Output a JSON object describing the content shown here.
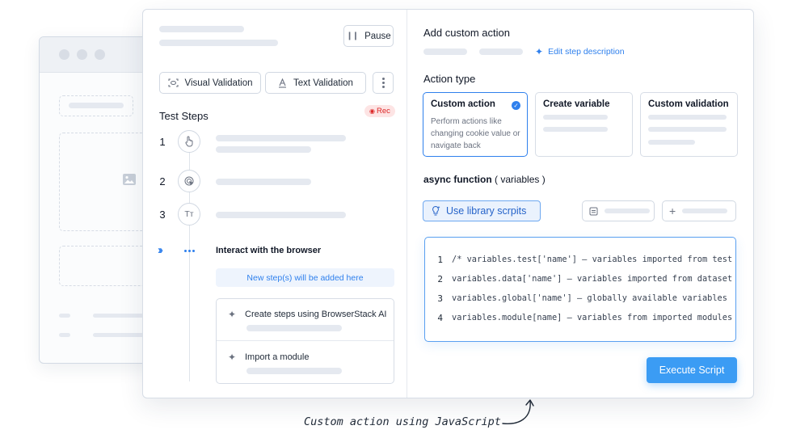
{
  "left_panel": {
    "pause_label": "Pause",
    "visual_validation_label": "Visual Validation",
    "text_validation_label": "Text Validation",
    "test_steps_title": "Test Steps",
    "rec_label": "Rec",
    "steps": [
      {
        "number": "1",
        "icon": "hand-pointer-icon"
      },
      {
        "number": "2",
        "icon": "cursor-click-icon"
      },
      {
        "number": "3",
        "icon": "text-type-icon"
      }
    ],
    "interact_label": "Interact with the browser",
    "new_step_hint": "New step(s) will be added here",
    "options": [
      {
        "label": "Create steps using BrowserStack AI"
      },
      {
        "label": "Import a module"
      }
    ]
  },
  "right_panel": {
    "add_custom_action_title": "Add custom action",
    "edit_step_description": "Edit step description",
    "action_type_title": "Action type",
    "action_types": [
      {
        "title": "Custom action",
        "description": "Perform actions like changing cookie value or navigate back",
        "selected": true
      },
      {
        "title": "Create variable",
        "selected": false
      },
      {
        "title": "Custom validation",
        "selected": false
      }
    ],
    "async_function_bold": "async function",
    "async_function_args": "( variables )",
    "use_library_label": "Use library scrpits",
    "code_lines": [
      {
        "num": "1",
        "text": "/* variables.test['name'] – variables imported from test"
      },
      {
        "num": "2",
        "text": "variables.data['name'] – variables imported from dataset"
      },
      {
        "num": "3",
        "text": "variables.global['name'] – globally available variables"
      },
      {
        "num": "4",
        "text": "variables.module[name] – variables from imported modules"
      }
    ],
    "execute_label": "Execute Script"
  },
  "caption": "Custom action using JavaScript",
  "colors": {
    "accent": "#2f80ed",
    "execute_button": "#3b9cf4",
    "rec_badge_bg": "#fde4e4",
    "rec_badge_text": "#dc2626"
  }
}
